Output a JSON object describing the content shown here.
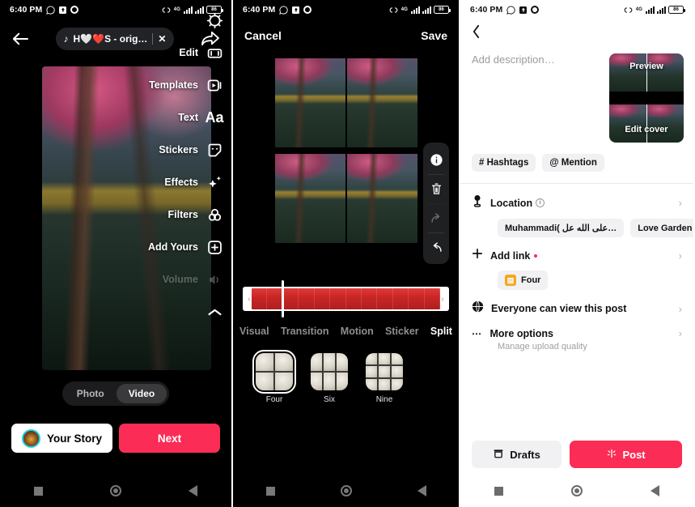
{
  "status_bar": {
    "time": "6:40 PM",
    "network": "4G",
    "battery": "86",
    "icons": [
      "whatsapp-icon",
      "sdcard-icon",
      "gear-icon",
      "vibrate-icon",
      "signal-icon",
      "signal2-icon",
      "battery-icon"
    ]
  },
  "panel1": {
    "name": "story-camera-editor",
    "back_icon": "back-arrow-icon",
    "music": {
      "note": "♪",
      "title": "H🤍❤️S - orig…",
      "close": "✕"
    },
    "share_icon": "share-arrow-icon",
    "menu": [
      {
        "label": "",
        "icon": "adjust-icon",
        "faded": false
      },
      {
        "label": "Edit",
        "icon": "crop-icon",
        "faded": false
      },
      {
        "label": "Templates",
        "icon": "template-icon",
        "faded": false
      },
      {
        "label": "Text",
        "icon": "text-aa-icon",
        "faded": false
      },
      {
        "label": "Stickers",
        "icon": "sticker-icon",
        "faded": false
      },
      {
        "label": "Effects",
        "icon": "sparkle-icon",
        "faded": false
      },
      {
        "label": "Filters",
        "icon": "filters-icon",
        "faded": false
      },
      {
        "label": "Add Yours",
        "icon": "plus-box-icon",
        "faded": false
      },
      {
        "label": "Volume",
        "icon": "volume-icon",
        "faded": true
      },
      {
        "label": "",
        "icon": "chevron-up-icon",
        "faded": false
      }
    ],
    "modes": [
      {
        "label": "Photo",
        "active": false
      },
      {
        "label": "Video",
        "active": true
      }
    ],
    "story_button": "Your Story",
    "next_button": "Next",
    "accent": "#fb2c55"
  },
  "panel2": {
    "name": "video-split-editor",
    "cancel": "Cancel",
    "save": "Save",
    "tools": [
      {
        "name": "info-icon",
        "dim": false
      },
      {
        "name": "trash-icon",
        "dim": false
      },
      {
        "name": "redo-icon",
        "dim": true
      },
      {
        "name": "undo-icon",
        "dim": false
      }
    ],
    "tabs": [
      {
        "label": "Visual",
        "active": false
      },
      {
        "label": "Transition",
        "active": false
      },
      {
        "label": "Motion",
        "active": false
      },
      {
        "label": "Sticker",
        "active": false
      },
      {
        "label": "Split",
        "active": true
      }
    ],
    "grid_options": [
      {
        "label": "Four",
        "cells": 4,
        "selected": true
      },
      {
        "label": "Six",
        "cells": 6,
        "selected": false
      },
      {
        "label": "Nine",
        "cells": 9,
        "selected": false
      }
    ]
  },
  "panel3": {
    "name": "post-publish-screen",
    "back_icon": "chevron-left-icon",
    "description_placeholder": "Add description…",
    "cover": {
      "preview_label": "Preview",
      "edit_label": "Edit cover"
    },
    "tags": [
      {
        "label": "# Hashtags"
      },
      {
        "label": "@ Mention"
      }
    ],
    "location": {
      "icon": "location-pin-icon",
      "title": "Location",
      "info": "i",
      "arrow": "›",
      "chips": [
        "Muhammadi( على الله عل…",
        "Love Garden ❤️ Touri"
      ]
    },
    "add_link": {
      "icon": "plus-icon",
      "title": "Add link",
      "arrow": "›",
      "chip": {
        "icon": "link-thumb-icon",
        "label": "Four"
      }
    },
    "privacy": {
      "icon": "globe-icon",
      "title": "Everyone can view this post",
      "arrow": "›"
    },
    "more": {
      "icon": "dots-icon",
      "title": "More options",
      "subtitle": "Manage upload quality",
      "arrow": "›"
    },
    "drafts_button": {
      "icon": "drafts-icon",
      "label": "Drafts"
    },
    "post_button": {
      "icon": "post-spark-icon",
      "label": "Post"
    },
    "accent": "#fb2c55"
  }
}
